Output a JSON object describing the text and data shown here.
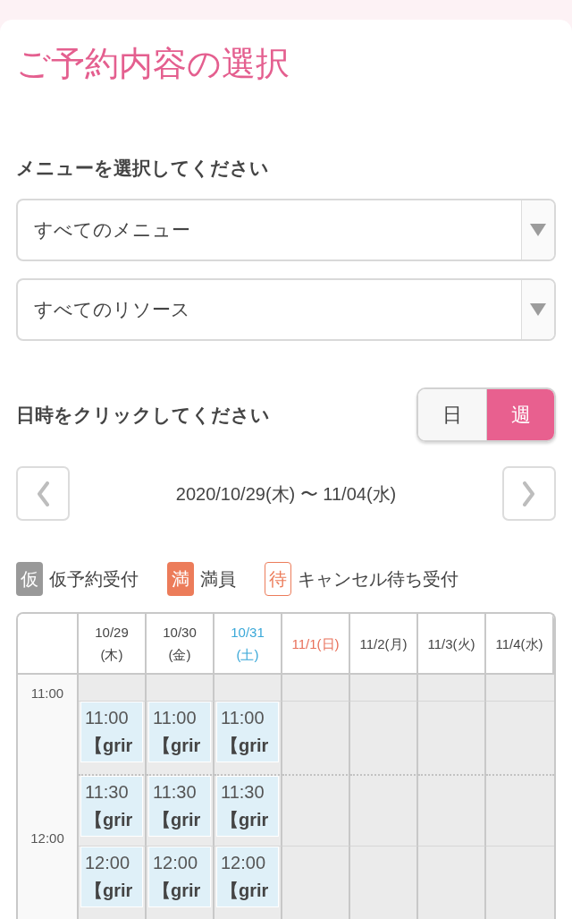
{
  "title": "ご予約内容の選択",
  "menu_section": {
    "label": "メニューを選択してください",
    "selects": [
      {
        "value": "すべてのメニュー"
      },
      {
        "value": "すべてのリソース"
      }
    ]
  },
  "date_section": {
    "label": "日時をクリックしてください",
    "view_toggle": [
      {
        "label": "日",
        "selected": false
      },
      {
        "label": "週",
        "selected": true
      }
    ],
    "range": "2020/10/29(木) 〜 11/04(水)"
  },
  "legend": [
    {
      "kind": "tentative",
      "badge": "仮",
      "label": "仮予約受付"
    },
    {
      "kind": "full",
      "badge": "満",
      "label": "満員"
    },
    {
      "kind": "waitlist",
      "badge": "待",
      "label": "キャンセル待ち受付"
    }
  ],
  "calendar": {
    "days": [
      {
        "lines": [
          "10/29",
          "(木)"
        ],
        "kind": "weekday"
      },
      {
        "lines": [
          "10/30",
          "(金)"
        ],
        "kind": "weekday"
      },
      {
        "lines": [
          "10/31",
          "(土)"
        ],
        "kind": "saturday"
      },
      {
        "lines": [
          "11/1(日)"
        ],
        "kind": "sunday"
      },
      {
        "lines": [
          "11/2(月)"
        ],
        "kind": "weekday"
      },
      {
        "lines": [
          "11/3(火)"
        ],
        "kind": "weekday"
      },
      {
        "lines": [
          "11/4(水)"
        ],
        "kind": "weekday"
      }
    ],
    "rows": [
      {
        "time_label": "11:00",
        "slots": [
          {
            "open": true,
            "time": "11:00",
            "title": "【grir"
          },
          {
            "open": true,
            "time": "11:00",
            "title": "【grir"
          },
          {
            "open": true,
            "time": "11:00",
            "title": "【grir"
          },
          {
            "open": false
          },
          {
            "open": false
          },
          {
            "open": false
          },
          {
            "open": false
          }
        ]
      },
      {
        "slots": [
          {
            "open": true,
            "time": "11:30",
            "title": "【grir"
          },
          {
            "open": true,
            "time": "11:30",
            "title": "【grir"
          },
          {
            "open": true,
            "time": "11:30",
            "title": "【grir"
          },
          {
            "open": false
          },
          {
            "open": false
          },
          {
            "open": false
          },
          {
            "open": false
          }
        ]
      },
      {
        "time_label": "12:00",
        "slots": [
          {
            "open": true,
            "time": "12:00",
            "title": "【grir"
          },
          {
            "open": true,
            "time": "12:00",
            "title": "【grir"
          },
          {
            "open": true,
            "time": "12:00",
            "title": "【grir"
          },
          {
            "open": false
          },
          {
            "open": false
          },
          {
            "open": false
          },
          {
            "open": false
          }
        ]
      }
    ]
  }
}
